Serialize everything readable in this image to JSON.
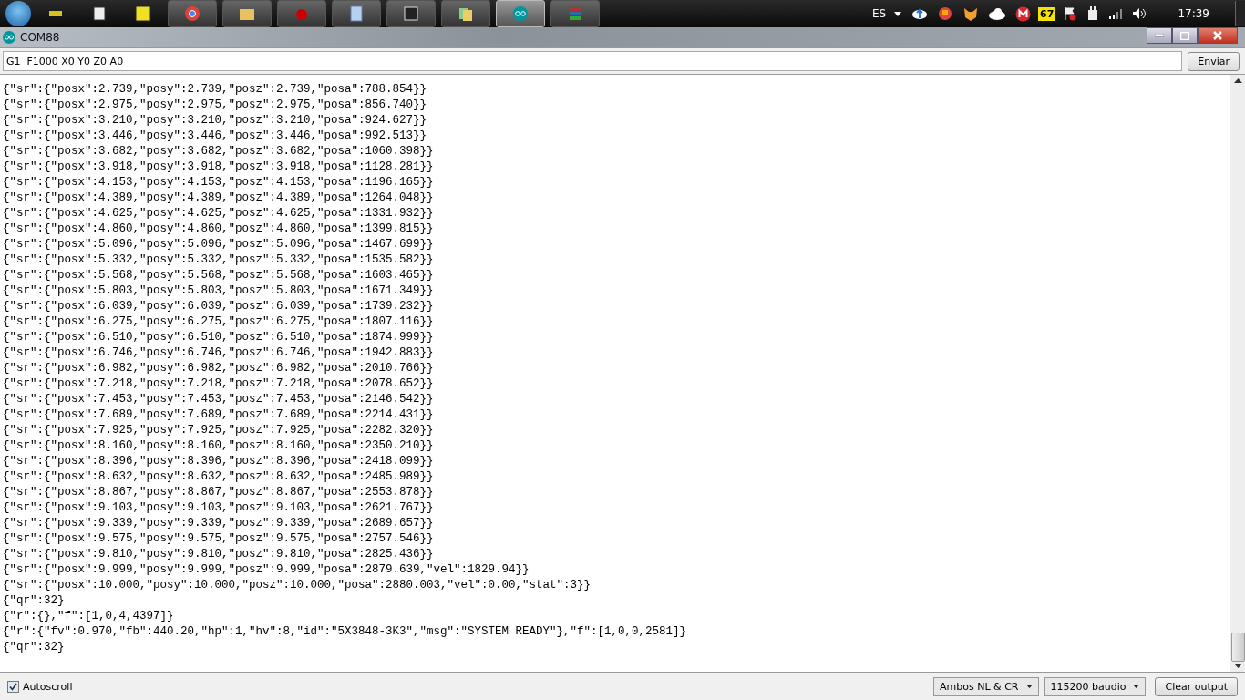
{
  "taskbar": {
    "apps": [
      {
        "selected": false
      },
      {
        "selected": false
      },
      {
        "selected": false
      },
      {
        "selected": false
      },
      {
        "selected": false
      },
      {
        "selected": false
      },
      {
        "selected": false
      },
      {
        "selected": false
      },
      {
        "selected": false
      },
      {
        "selected": true
      },
      {
        "selected": false
      }
    ],
    "tray": {
      "language": "ES",
      "badge": "67",
      "clock": "17:39"
    }
  },
  "window": {
    "title": "COM88"
  },
  "command": {
    "value": "G1  F1000 X0 Y0 Z0 A0",
    "send_button": "Enviar"
  },
  "output": [
    "{\"sr\":{\"posx\":2.739,\"posy\":2.739,\"posz\":2.739,\"posa\":788.854}}",
    "{\"sr\":{\"posx\":2.975,\"posy\":2.975,\"posz\":2.975,\"posa\":856.740}}",
    "{\"sr\":{\"posx\":3.210,\"posy\":3.210,\"posz\":3.210,\"posa\":924.627}}",
    "{\"sr\":{\"posx\":3.446,\"posy\":3.446,\"posz\":3.446,\"posa\":992.513}}",
    "{\"sr\":{\"posx\":3.682,\"posy\":3.682,\"posz\":3.682,\"posa\":1060.398}}",
    "{\"sr\":{\"posx\":3.918,\"posy\":3.918,\"posz\":3.918,\"posa\":1128.281}}",
    "{\"sr\":{\"posx\":4.153,\"posy\":4.153,\"posz\":4.153,\"posa\":1196.165}}",
    "{\"sr\":{\"posx\":4.389,\"posy\":4.389,\"posz\":4.389,\"posa\":1264.048}}",
    "{\"sr\":{\"posx\":4.625,\"posy\":4.625,\"posz\":4.625,\"posa\":1331.932}}",
    "{\"sr\":{\"posx\":4.860,\"posy\":4.860,\"posz\":4.860,\"posa\":1399.815}}",
    "{\"sr\":{\"posx\":5.096,\"posy\":5.096,\"posz\":5.096,\"posa\":1467.699}}",
    "{\"sr\":{\"posx\":5.332,\"posy\":5.332,\"posz\":5.332,\"posa\":1535.582}}",
    "{\"sr\":{\"posx\":5.568,\"posy\":5.568,\"posz\":5.568,\"posa\":1603.465}}",
    "{\"sr\":{\"posx\":5.803,\"posy\":5.803,\"posz\":5.803,\"posa\":1671.349}}",
    "{\"sr\":{\"posx\":6.039,\"posy\":6.039,\"posz\":6.039,\"posa\":1739.232}}",
    "{\"sr\":{\"posx\":6.275,\"posy\":6.275,\"posz\":6.275,\"posa\":1807.116}}",
    "{\"sr\":{\"posx\":6.510,\"posy\":6.510,\"posz\":6.510,\"posa\":1874.999}}",
    "{\"sr\":{\"posx\":6.746,\"posy\":6.746,\"posz\":6.746,\"posa\":1942.883}}",
    "{\"sr\":{\"posx\":6.982,\"posy\":6.982,\"posz\":6.982,\"posa\":2010.766}}",
    "{\"sr\":{\"posx\":7.218,\"posy\":7.218,\"posz\":7.218,\"posa\":2078.652}}",
    "{\"sr\":{\"posx\":7.453,\"posy\":7.453,\"posz\":7.453,\"posa\":2146.542}}",
    "{\"sr\":{\"posx\":7.689,\"posy\":7.689,\"posz\":7.689,\"posa\":2214.431}}",
    "{\"sr\":{\"posx\":7.925,\"posy\":7.925,\"posz\":7.925,\"posa\":2282.320}}",
    "{\"sr\":{\"posx\":8.160,\"posy\":8.160,\"posz\":8.160,\"posa\":2350.210}}",
    "{\"sr\":{\"posx\":8.396,\"posy\":8.396,\"posz\":8.396,\"posa\":2418.099}}",
    "{\"sr\":{\"posx\":8.632,\"posy\":8.632,\"posz\":8.632,\"posa\":2485.989}}",
    "{\"sr\":{\"posx\":8.867,\"posy\":8.867,\"posz\":8.867,\"posa\":2553.878}}",
    "{\"sr\":{\"posx\":9.103,\"posy\":9.103,\"posz\":9.103,\"posa\":2621.767}}",
    "{\"sr\":{\"posx\":9.339,\"posy\":9.339,\"posz\":9.339,\"posa\":2689.657}}",
    "{\"sr\":{\"posx\":9.575,\"posy\":9.575,\"posz\":9.575,\"posa\":2757.546}}",
    "{\"sr\":{\"posx\":9.810,\"posy\":9.810,\"posz\":9.810,\"posa\":2825.436}}",
    "{\"sr\":{\"posx\":9.999,\"posy\":9.999,\"posz\":9.999,\"posa\":2879.639,\"vel\":1829.94}}",
    "{\"sr\":{\"posx\":10.000,\"posy\":10.000,\"posz\":10.000,\"posa\":2880.003,\"vel\":0.00,\"stat\":3}}",
    "{\"qr\":32}",
    "{\"r\":{},\"f\":[1,0,4,4397]}",
    "{\"r\":{\"fv\":0.970,\"fb\":440.20,\"hp\":1,\"hv\":8,\"id\":\"5X3848-3K3\",\"msg\":\"SYSTEM READY\"},\"f\":[1,0,0,2581]}",
    "{\"qr\":32}"
  ],
  "footer": {
    "autoscroll": {
      "label": "Autoscroll",
      "checked": true
    },
    "line_ending": "Ambos NL & CR",
    "baud_rate": "115200 baudio",
    "clear_button": "Clear output"
  }
}
